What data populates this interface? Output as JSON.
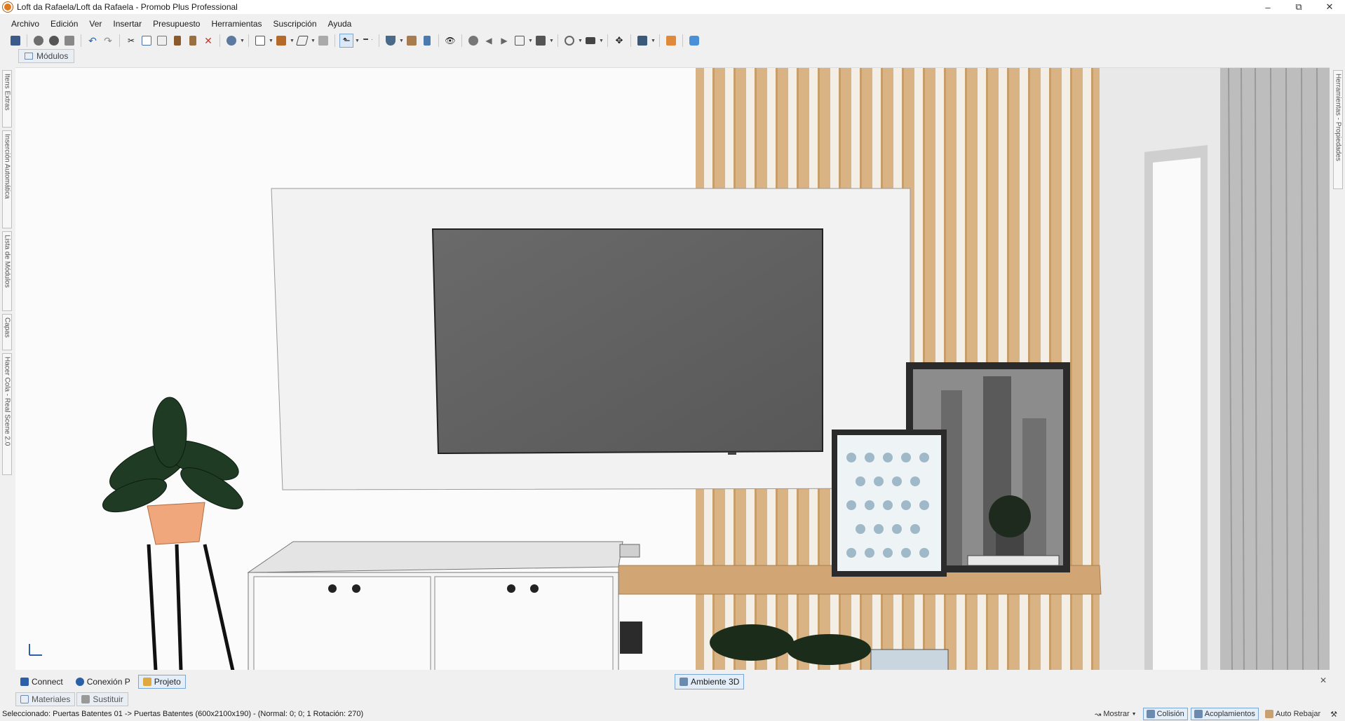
{
  "window": {
    "title": "Loft da Rafaela/Loft da Rafaela - Promob Plus Professional",
    "minimize": "–",
    "restore": "⧉",
    "close": "✕"
  },
  "menu": [
    "Archivo",
    "Edición",
    "Ver",
    "Insertar",
    "Presupuesto",
    "Herramientas",
    "Suscripción",
    "Ayuda"
  ],
  "toolbar_icons": [
    "save-icon",
    "open-icon",
    "render-icon",
    "print-icon",
    "undo-icon",
    "redo-icon",
    "cut-icon",
    "copy-icon",
    "paste-icon",
    "hammer-icon",
    "paint-icon",
    "delete-icon",
    "sphere-icon",
    "layout-icon",
    "modules-icon",
    "shape-icon",
    "gray-icon",
    "select-icon",
    "measure-icon",
    "shield-icon",
    "cabinet-icon",
    "3d-icon",
    "eye-icon",
    "rotate-icon",
    "left-icon",
    "right-icon",
    "view-icon",
    "box-icon",
    "link-icon",
    "camera-icon",
    "move-icon",
    "list-icon",
    "person-icon",
    "chat-icon"
  ],
  "modulos_tab": "Módulos",
  "left_rail": [
    "Itens Extras",
    "Inserción Automática",
    "Lista de Módulos",
    "Capas",
    "Hacer Cola - Real Scene 2.0"
  ],
  "right_rail": [
    "Herramientas - Propiedades"
  ],
  "bottom_tabs": {
    "connect": "Connect",
    "conexion": "Conexión P",
    "projeto": "Projeto",
    "ambiente": "Ambiente 3D",
    "close": "✕"
  },
  "side_tabs": {
    "materiales": "Materiales",
    "sustituir": "Sustituir"
  },
  "status": {
    "text": "Seleccionado: Puertas Batentes 01 -> Puertas Batentes (600x2100x190) - (Normal: 0; 0; 1 Rotación: 270)",
    "mostrar": "Mostrar",
    "colision": "Colisión",
    "acoplamientos": "Acoplamientos",
    "auto_rebajar": "Auto Rebajar"
  },
  "colors": {
    "accent": "#7aa6d6",
    "wood": "#d9b383",
    "tv": "#5f5f5f",
    "panel": "#f2f2f2"
  }
}
